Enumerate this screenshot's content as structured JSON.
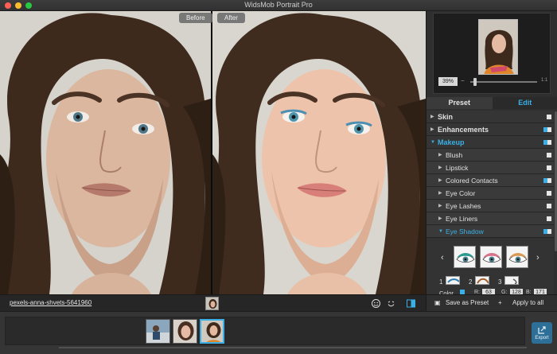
{
  "window": {
    "title": "WidsMob Portrait Pro"
  },
  "canvas": {
    "before_label": "Before",
    "after_label": "After"
  },
  "navigator": {
    "zoom": "39%",
    "fit_label": "1:1"
  },
  "tabs": {
    "preset": "Preset",
    "edit": "Edit",
    "active": "Edit"
  },
  "adjustments": {
    "skin": "Skin",
    "enhancements": "Enhancements",
    "makeup": "Makeup",
    "blush": "Blush",
    "lipstick": "Lipstick",
    "colored_contacts": "Colored Contacts",
    "eye_color": "Eye Color",
    "eye_lashes": "Eye Lashes",
    "eye_liners": "Eye Liners",
    "eye_shadow": "Eye Shadow"
  },
  "eye_shadow_panel": {
    "shape_numbers": [
      "1",
      "2",
      "3"
    ],
    "color_label": "Color",
    "r_label": "R:",
    "g_label": "G:",
    "b_label": "B:",
    "r": "63",
    "g": "128",
    "b": "171",
    "swatch_color": "#3ab0e6"
  },
  "file": {
    "name": "pexels-anna-shvets-5641960"
  },
  "actions": {
    "save_preset": "Save as Preset",
    "apply_all": "Apply to all"
  },
  "export": {
    "label": "Export"
  },
  "colors": {
    "accent": "#3ab0e6"
  }
}
